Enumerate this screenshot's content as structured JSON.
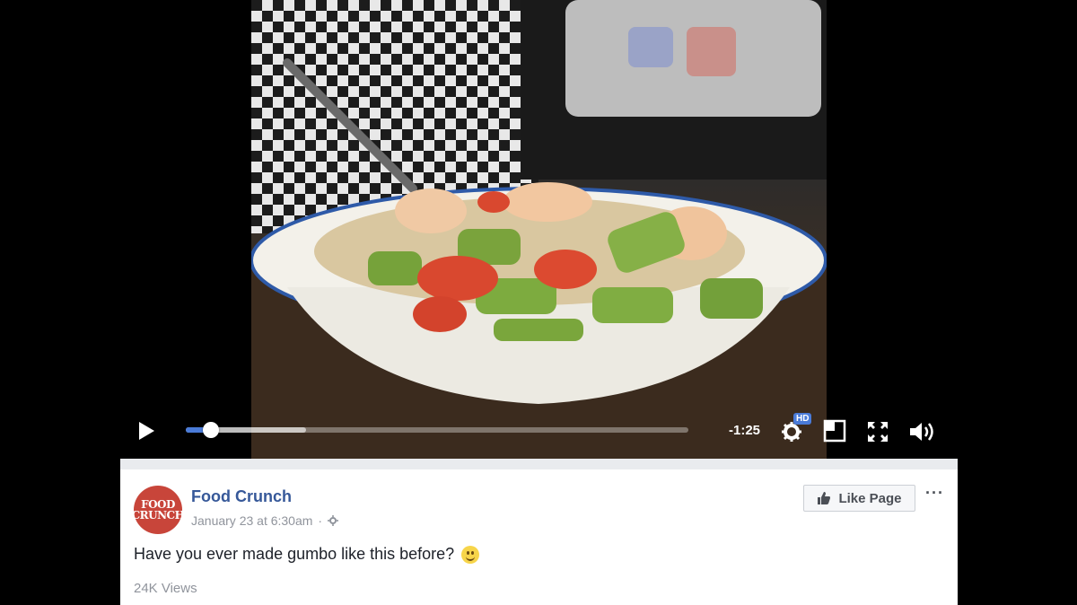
{
  "video": {
    "time_remaining": "-1:25",
    "progress": 0.05,
    "buffered": 0.24,
    "quality_badge": "HD"
  },
  "post": {
    "page_name": "Food Crunch",
    "timestamp": "January 23 at 6:30am",
    "privacy_icon": "gear-icon",
    "like_page_label": "Like Page",
    "more_label": "···",
    "text": "Have you ever made gumbo like this before?",
    "views": "24K Views",
    "avatar_line1": "FOOD",
    "avatar_line2": "CRUNCH"
  },
  "colors": {
    "accent": "#4a7bd8",
    "link": "#365899",
    "avatar": "#c8453a"
  }
}
